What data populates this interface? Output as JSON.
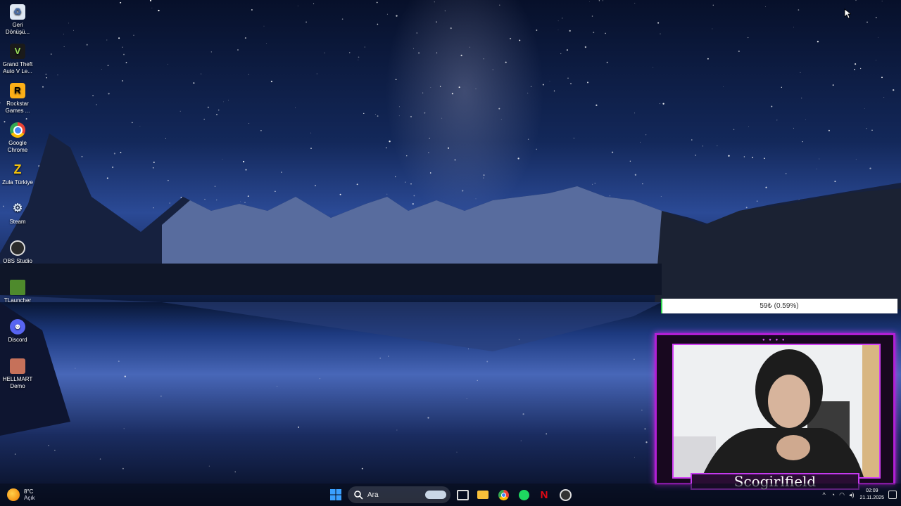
{
  "desktop": {
    "icons": [
      {
        "label": "Geri Dönüşü...",
        "icon": "recycle-bin-icon"
      },
      {
        "label": "Grand Theft Auto V Le...",
        "icon": "gta-v-icon"
      },
      {
        "label": "Rockstar Games ...",
        "icon": "rockstar-icon"
      },
      {
        "label": "Google Chrome",
        "icon": "chrome-icon"
      },
      {
        "label": "Zula Türkiye",
        "icon": "zula-icon"
      },
      {
        "label": "Steam",
        "icon": "steam-icon"
      },
      {
        "label": "OBS Studio",
        "icon": "obs-icon"
      },
      {
        "label": "TLauncher",
        "icon": "tlauncher-icon"
      },
      {
        "label": "Discord",
        "icon": "discord-icon"
      },
      {
        "label": "HELLMART Demo",
        "icon": "hellmart-icon"
      }
    ]
  },
  "overlay": {
    "donation_goal": {
      "text": "59₺ (0.59%)",
      "fraction": 0.0059,
      "fill_color": "#2fd24c"
    },
    "webcam": {
      "name": "Scogirlfield",
      "frame_color": "#b11fd4"
    }
  },
  "taskbar": {
    "weather": {
      "temp": "8°C",
      "condition": "Açık"
    },
    "search": {
      "label": "Ara"
    },
    "pinned": [
      "start-icon",
      "task-view-icon",
      "file-explorer-icon",
      "chrome-icon",
      "spotify-icon",
      "netflix-icon",
      "obs-icon"
    ],
    "clock": {
      "time": "02:09",
      "date": "21.11.2025"
    }
  }
}
